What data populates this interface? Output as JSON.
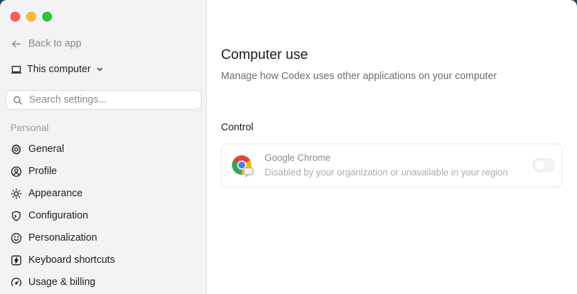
{
  "sidebar": {
    "back_label": "Back to app",
    "device_label": "This computer",
    "search_placeholder": "Search settings...",
    "section_label": "Personal",
    "items": [
      {
        "label": "General",
        "icon": "gear-icon"
      },
      {
        "label": "Profile",
        "icon": "profile-icon"
      },
      {
        "label": "Appearance",
        "icon": "sun-icon"
      },
      {
        "label": "Configuration",
        "icon": "shield-icon"
      },
      {
        "label": "Personalization",
        "icon": "smiley-icon"
      },
      {
        "label": "Keyboard shortcuts",
        "icon": "bolt-icon"
      },
      {
        "label": "Usage & billing",
        "icon": "gauge-icon"
      }
    ]
  },
  "main": {
    "title": "Computer use",
    "description": "Manage how Codex uses other applications on your computer",
    "control_label": "Control",
    "app": {
      "name": "Google Chrome",
      "status": "Disabled by your organization or unavailable in your region",
      "enabled": false
    }
  },
  "colors": {
    "sidebar_bg": "#f3f3f4",
    "main_bg": "#ffffff",
    "close": "#ff5f57",
    "minimize": "#febc2e",
    "maximize": "#28c840"
  }
}
